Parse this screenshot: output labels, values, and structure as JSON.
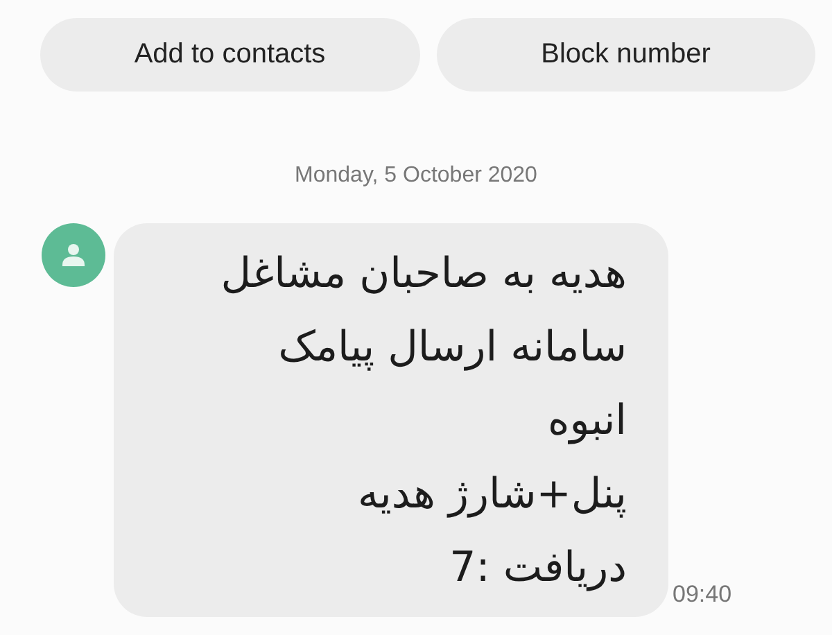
{
  "add_contact_button": {
    "label": "Add to contacts"
  },
  "block_number_button": {
    "label": "Block number"
  },
  "date": "Monday, 5 October 2020",
  "messages": [
    {
      "text": "هدیه به صاحبان مشاغل\nسامانه ارسال پیامک\nانبوه\nپنل+شارژ هدیه\nدریافت :7",
      "time": "09:40"
    }
  ]
}
